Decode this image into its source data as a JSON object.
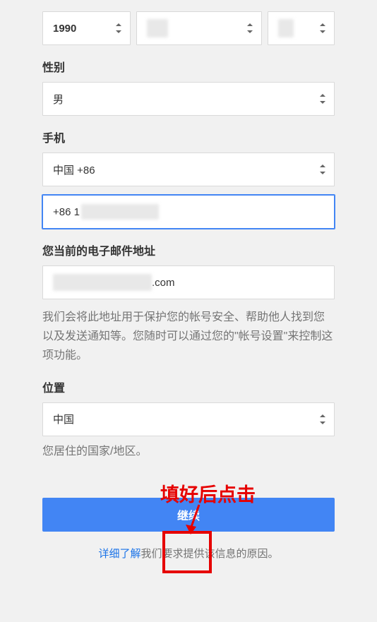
{
  "birth": {
    "year": "1990"
  },
  "gender": {
    "label": "性别",
    "value": "男"
  },
  "phone": {
    "label": "手机",
    "country": "中国 +86",
    "prefix": "+86 1"
  },
  "email": {
    "label": "您当前的电子邮件地址",
    "suffix": ".com",
    "help": "我们会将此地址用于保护您的帐号安全、帮助他人找到您以及发送通知等。您随时可以通过您的\"帐号设置\"来控制这项功能。"
  },
  "location": {
    "label": "位置",
    "value": "中国",
    "help": "您居住的国家/地区。"
  },
  "continue": "继续",
  "bottomlink": {
    "link": "详细了解",
    "rest": "我们要求提供该信息的原因。"
  },
  "annotation": {
    "text": "填好后点击"
  }
}
